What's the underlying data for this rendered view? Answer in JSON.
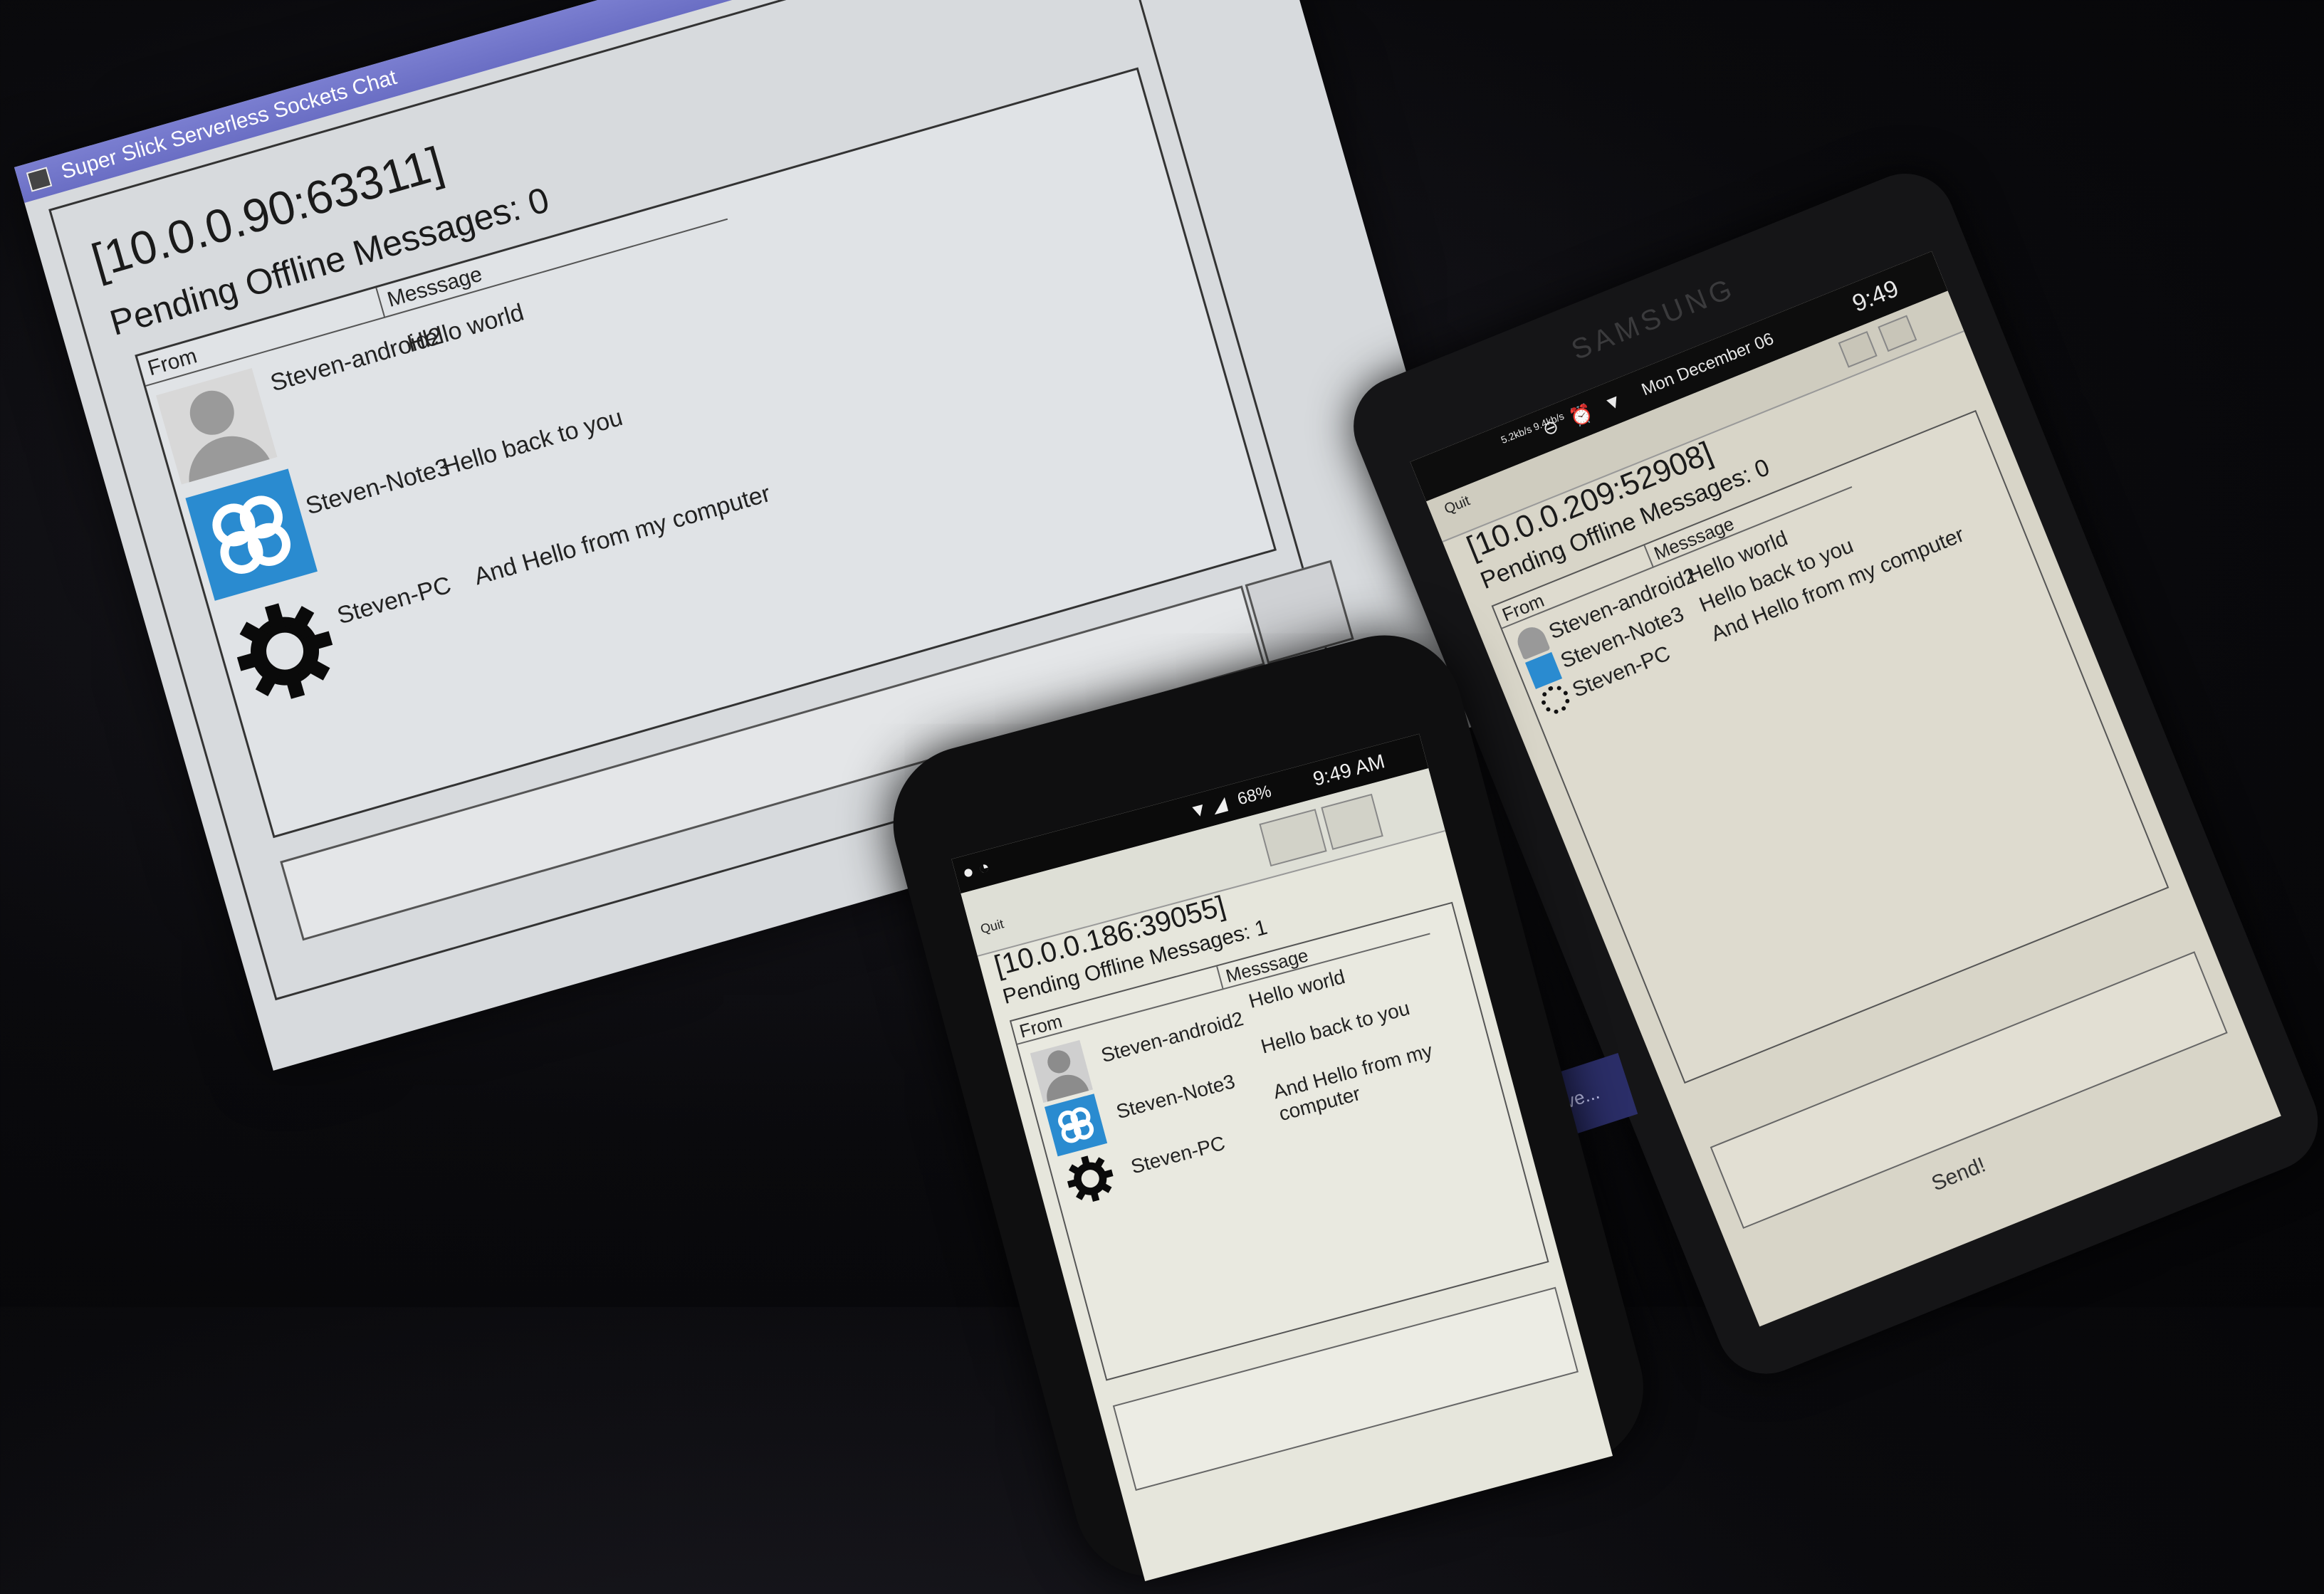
{
  "desktop": {
    "title": "Super Slick Serverless Sockets Chat",
    "endpoint": "[10.0.0.90:63311]",
    "pending": "Pending Offline Messages: 0",
    "columns": {
      "from": "From",
      "message": "Messsage"
    },
    "rows": [
      {
        "from": "Steven-android2",
        "message": "Hello world",
        "avatar": "person-icon"
      },
      {
        "from": "Steven-Note3",
        "message": "Hello back to you",
        "avatar": "cloud-icon"
      },
      {
        "from": "Steven-PC",
        "message": "And Hello from my computer",
        "avatar": "gear-icon"
      }
    ]
  },
  "samsung": {
    "brand": "SAMSUNG",
    "status": {
      "date": "Mon December 06",
      "time": "9:49",
      "rate": "5.2kb/s 9.4kb/s"
    },
    "quit": "Quit",
    "endpoint": "[10.0.0.209:52908]",
    "pending": "Pending Offline Messages: 0",
    "columns": {
      "from": "From",
      "message": "Messsage"
    },
    "rows": [
      {
        "from": "Steven-android2",
        "message": "Hello world"
      },
      {
        "from": "Steven-Note3",
        "message": "Hello back to you"
      },
      {
        "from": "Steven-PC",
        "message": "And Hello from my computer"
      }
    ],
    "send": "Send!"
  },
  "nexus": {
    "status": {
      "battery": "68%",
      "time": "9:49 AM"
    },
    "quit": "Quit",
    "endpoint": "[10.0.0.186:39055]",
    "pending": "Pending Offline Messages: 1",
    "columns": {
      "from": "From",
      "message": "Messsage"
    },
    "rows": [
      {
        "from": "Steven-android2",
        "message": "Hello world"
      },
      {
        "from": "Steven-Note3",
        "message": "Hello back to you"
      },
      {
        "from": "Steven-PC",
        "message": "And Hello from my computer"
      }
    ]
  },
  "server_tab": "Serve..."
}
